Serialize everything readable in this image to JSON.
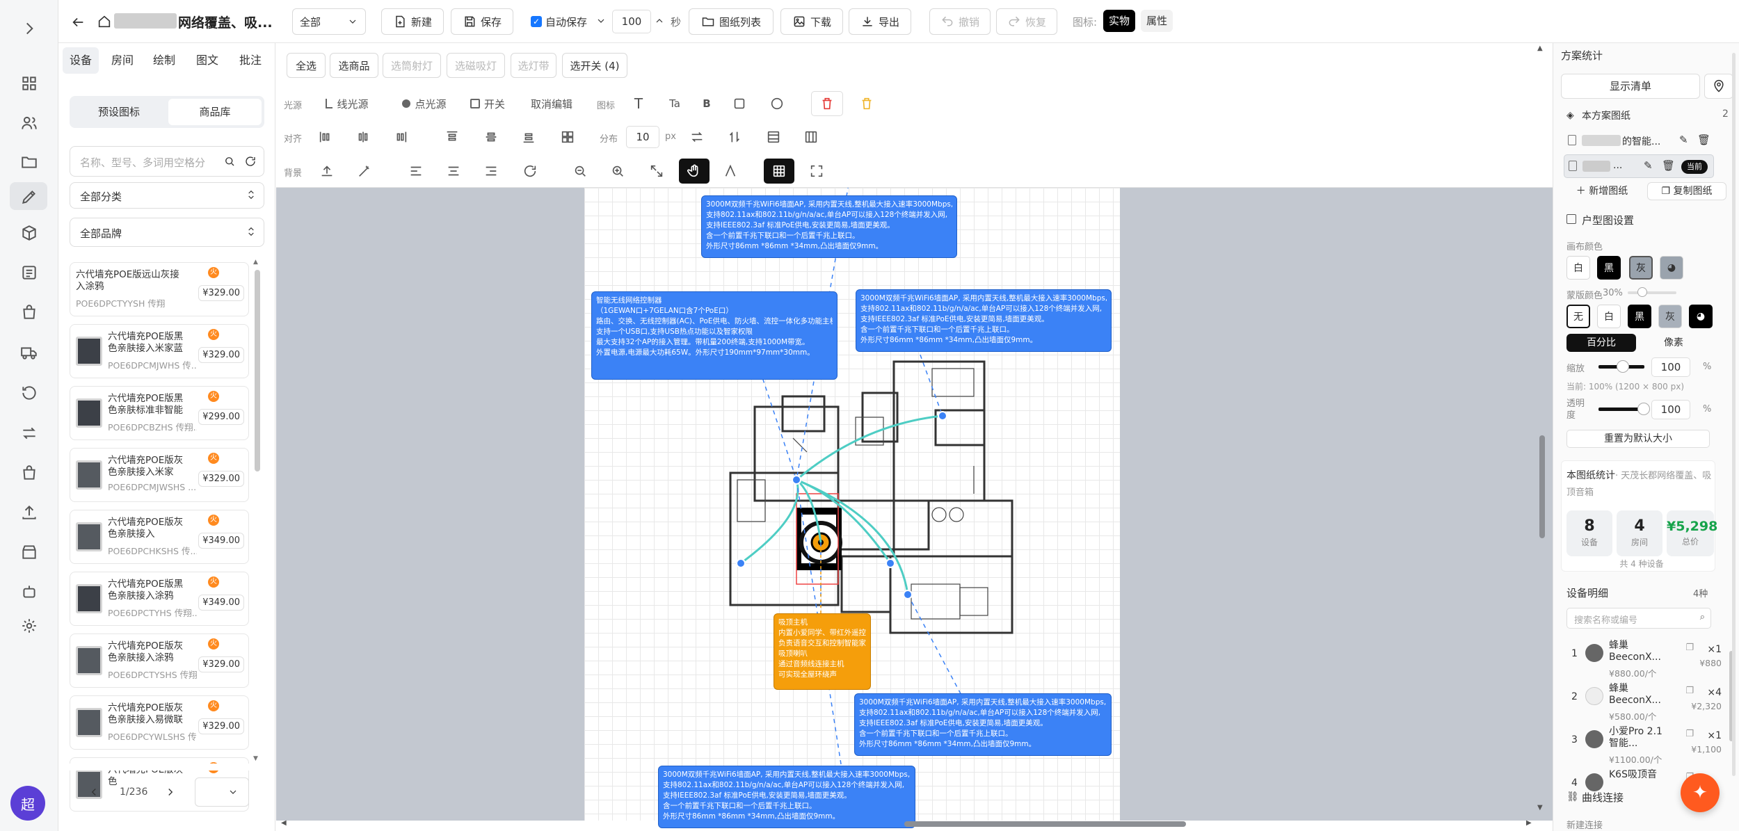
{
  "rail": {
    "avatar": "超",
    "icons": [
      "expand-icon",
      "grid-icon",
      "users-icon",
      "folder-icon",
      "pen-icon",
      "cube-icon",
      "list-icon",
      "bag-icon",
      "truck-icon",
      "history-icon",
      "swap-icon",
      "bag-check-icon",
      "upload-icon",
      "store-icon",
      "robot-icon",
      "settings-icon"
    ]
  },
  "topbar": {
    "title": "网络覆盖、吸...",
    "scope": "全部",
    "new": "新建",
    "save": "保存",
    "autosave": "自动保存",
    "interval": "100",
    "interval_unit": "秒",
    "drawing_list": "图纸列表",
    "download": "下载",
    "export": "导出",
    "undo": "撤销",
    "redo": "恢复",
    "icon_label": "图标:",
    "icon_real": "实物",
    "icon_attr": "属性"
  },
  "left": {
    "tabs": [
      "设备",
      "房间",
      "绘制",
      "图文",
      "批注"
    ],
    "subtabs": [
      "预设图标",
      "商品库"
    ],
    "search_placeholder": "名称、型号、多词用空格分",
    "category": "全部分类",
    "brand": "全部品牌",
    "page": "1/236",
    "products": [
      {
        "name": "六代墙充POE版远山灰接入涂鸦",
        "sku": "POE6DPCTYYSH 传翔...",
        "price": "¥329.00"
      },
      {
        "name": "六代墙充POE版黑色亲肤接入米家蓝牙...",
        "sku": "POE6DPCMJWHS 传...",
        "price": "¥329.00"
      },
      {
        "name": "六代墙充POE版黑色亲肤标准非智能版",
        "sku": "POE6DPCBZHS 传翔...",
        "price": "¥299.00"
      },
      {
        "name": "六代墙充POE版灰色亲肤接入米家WiFi",
        "sku": "POE6DPCMJWSHS ...",
        "price": "¥329.00"
      },
      {
        "name": "六代墙充POE版灰色亲肤接入Homekit",
        "sku": "POE6DPCHKSHS 传...",
        "price": "¥349.00"
      },
      {
        "name": "六代墙充POE版黑色亲肤接入涂鸦",
        "sku": "POE6DPCTYHS 传翔...",
        "price": "¥349.00"
      },
      {
        "name": "六代墙充POE版灰色亲肤接入涂鸦",
        "sku": "POE6DPCTYSHS 传翔...",
        "price": "¥329.00"
      },
      {
        "name": "六代墙充POE版灰色亲肤接入易微联华为",
        "sku": "POE6DPCYWLSHS 传...",
        "price": "¥329.00"
      },
      {
        "name": "六代墙充POE版灰色",
        "sku": "",
        "price": ""
      }
    ]
  },
  "toolbar": {
    "select_all": "全选",
    "select_goods": "选商品",
    "select_spot": "选筒射灯",
    "select_mag": "选磁吸灯",
    "select_strip": "选灯带",
    "select_switch": "选开关 (4)",
    "light_label": "光源",
    "line_light": "线光源",
    "point_light": "点光源",
    "switch": "开关",
    "cancel_edit": "取消编辑",
    "icon_label": "图标",
    "align_label": "对齐",
    "dist_label": "分布",
    "dist_value": "10",
    "dist_unit": "px",
    "bg_label": "背景"
  },
  "canvas": {
    "notes": [
      {
        "lines": [
          "3000M双频千兆WiFi6墙面AP, 采用内置天线,整机最大接入速率3000Mbps,",
          "支持802.11ax和802.11b/g/n/a/ac,单台AP可以接入128个终端并发入网,",
          "支持IEEE802.3af 标准PoE供电,安装更简易,墙面更美观。",
          "含一个前置千兆下联口和一个后置千兆上联口。",
          "外形尺寸86mm *86mm *34mm,凸出墙面仅9mm。"
        ]
      },
      {
        "lines": [
          "智能无线网络控制器",
          "（1GEWAN口+7GELAN口含7个PoE口）",
          "路由、交换、无线控制器(AC)、PoE供电、防火墙、流控一体化多功能主机",
          "支持一个USB口,支持USB热点功能以及智家权限",
          "最大支持32个AP的接入管理。带机量200终端,支持1000M带宽。",
          "外置电源,电源最大功耗65W。外形尺寸190mm*97mm*30mm。"
        ]
      },
      {
        "lines": [
          "3000M双频千兆WiFi6墙面AP, 采用内置天线,整机最大接入速率3000Mbps,",
          "支持802.11ax和802.11b/g/n/a/ac,单台AP可以接入128个终端并发入网,",
          "支持IEEE802.3af 标准PoE供电,安装更简易,墙面更美观。",
          "含一个前置千兆下联口和一个后置千兆上联口。",
          "外形尺寸86mm *86mm *34mm,凸出墙面仅9mm。"
        ]
      },
      {
        "lines": [
          "吸顶主机",
          "内置小爱同学、带红外遥控",
          "负责语音交互和控制智能家居",
          "吸顶喇叭",
          "通过音频线连接主机",
          "可实现全屋环绕声"
        ]
      },
      {
        "lines": [
          "3000M双频千兆WiFi6墙面AP, 采用内置天线,整机最大接入速率3000Mbps,",
          "支持802.11ax和802.11b/g/n/a/ac,单台AP可以接入128个终端并发入网,",
          "支持IEEE802.3af 标准PoE供电,安装更简易,墙面更美观。",
          "含一个前置千兆下联口和一个后置千兆上联口。",
          "外形尺寸86mm *86mm *34mm,凸出墙面仅9mm。"
        ]
      },
      {
        "lines": [
          "3000M双频千兆WiFi6墙面AP, 采用内置天线,整机最大接入速率3000Mbps,",
          "支持802.11ax和802.11b/g/n/a/ac,单台AP可以接入128个终端并发入网,",
          "支持IEEE802.3af 标准PoE供电,安装更简易,墙面更美观。",
          "含一个前置千兆下联口和一个后置千兆上联口。",
          "外形尺寸86mm *86mm *34mm,凸出墙面仅9mm。"
        ]
      }
    ]
  },
  "right": {
    "title": "方案统计",
    "show_list": "显示清单",
    "plans_title": "本方案图纸",
    "plans_count": "2",
    "plan1": "的智能...",
    "plan2": "...",
    "current_badge": "当前",
    "new_plan": "新增图纸",
    "copy_plan": "复制图纸",
    "house_title": "户型图设置",
    "canvas_color": "画布颜色",
    "mask_color": "蒙版颜色",
    "mask_pct": "30%",
    "c_white": "白",
    "c_black": "黑",
    "c_gray": "灰",
    "c_none": "无",
    "pct_tab": "百分比",
    "px_tab": "像素",
    "scale_label": "缩放",
    "scale_val": "100",
    "pct": "%",
    "current_size": "当前: 100% (1200 × 800 px)",
    "opacity_label": "透明度",
    "opacity_val": "100",
    "reset": "重置为默认大小",
    "stats_title": "本图纸统计",
    "stats_sub": "· 天茂长郡网络覆盖、吸顶音箱",
    "stat_devices": "8",
    "stat_devices_k": "设备",
    "stat_rooms": "4",
    "stat_rooms_k": "房间",
    "stat_total": "¥5,298",
    "stat_total_k": "总价",
    "kinds": "共 4 种设备",
    "detail_title": "设备明细",
    "detail_count": "4种",
    "detail_search": "搜索名称或编号",
    "details": [
      {
        "n": "1",
        "name": "蜂巢 BeeconX...",
        "unit": "¥880.00/个",
        "qty": "×1",
        "total": "¥880"
      },
      {
        "n": "2",
        "name": "蜂巢 BeeconX...",
        "unit": "¥580.00/个",
        "qty": "×4",
        "total": "¥2,320"
      },
      {
        "n": "3",
        "name": "小爱Pro 2.1智能...",
        "unit": "¥1100.00/个",
        "qty": "×1",
        "total": "¥1,100"
      },
      {
        "n": "4",
        "name": "K6S吸顶音",
        "unit": "",
        "qty": "",
        "total": ""
      }
    ],
    "curve_title": "曲线连接",
    "new_conn": "新建连接"
  }
}
